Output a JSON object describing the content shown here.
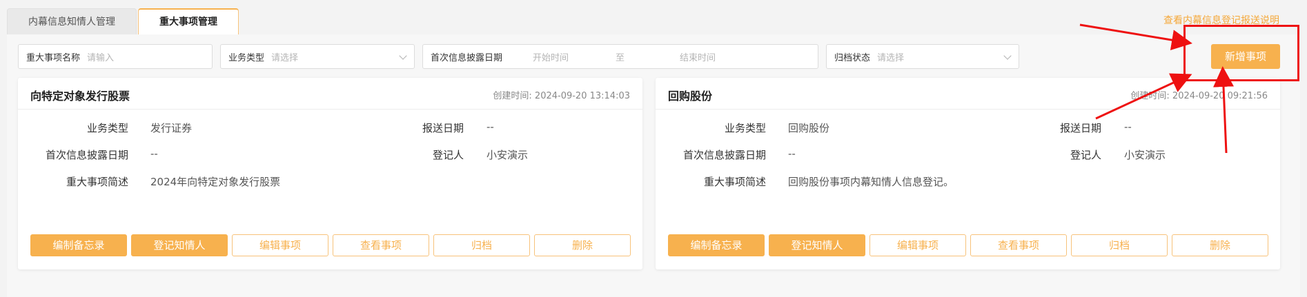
{
  "tabs": [
    {
      "label": "内幕信息知情人管理",
      "active": false
    },
    {
      "label": "重大事项管理",
      "active": true
    }
  ],
  "help_link": "查看内幕信息登记报送说明",
  "filters": {
    "name": {
      "label": "重大事项名称",
      "placeholder": "请输入"
    },
    "type": {
      "label": "业务类型",
      "placeholder": "请选择"
    },
    "date": {
      "label": "首次信息披露日期",
      "start_placeholder": "开始时间",
      "separator": "至",
      "end_placeholder": "结束时间"
    },
    "status": {
      "label": "归档状态",
      "placeholder": "请选择"
    }
  },
  "add_button": "新增事项",
  "field_labels": {
    "business_type": "业务类型",
    "report_date": "报送日期",
    "first_disclosure": "首次信息披露日期",
    "registrant": "登记人",
    "description": "重大事项简述",
    "created_prefix": "创建时间: "
  },
  "cards": [
    {
      "title": "向特定对象发行股票",
      "created": "2024-09-20 13:14:03",
      "business_type": "发行证券",
      "report_date": "--",
      "first_disclosure": "--",
      "registrant": "小安演示",
      "description": "2024年向特定对象发行股票"
    },
    {
      "title": "回购股份",
      "created": "2024-09-20 09:21:56",
      "business_type": "回购股份",
      "report_date": "--",
      "first_disclosure": "--",
      "registrant": "小安演示",
      "description": "回购股份事项内幕知情人信息登记。"
    }
  ],
  "card_buttons": {
    "memo": "编制备忘录",
    "register": "登记知情人",
    "edit": "编辑事项",
    "view": "查看事项",
    "archive": "归档",
    "delete": "删除"
  },
  "colors": {
    "accent": "#f7b14e",
    "annotation": "#ee1111"
  }
}
